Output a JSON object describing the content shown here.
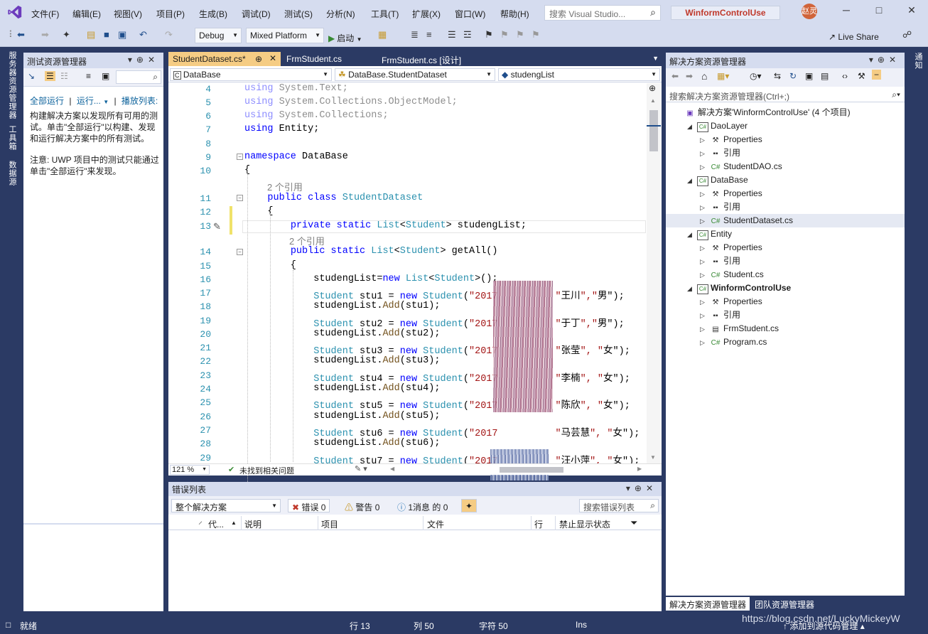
{
  "menu": [
    "文件(F)",
    "编辑(E)",
    "视图(V)",
    "项目(P)",
    "生成(B)",
    "调试(D)",
    "测试(S)",
    "分析(N)",
    "工具(T)",
    "扩展(X)",
    "窗口(W)",
    "帮助(H)"
  ],
  "search": {
    "placeholder": "搜索 Visual Studio..."
  },
  "solution_name": "WinformControlUse",
  "avatar_text": "赵灵",
  "toolbar": {
    "config": "Debug",
    "platform": "Mixed Platform",
    "start": "启动",
    "live_share": "Live Share"
  },
  "left_vtabs": [
    "服务器资源管理器",
    "工具箱",
    "数据源"
  ],
  "test_explorer": {
    "title": "测试资源管理器",
    "links": [
      "全部运行",
      "运行...",
      "播放列表:"
    ],
    "message1": "构建解决方案以发现所有可用的测试。单击\"全部运行\"以构建、发现和运行解决方案中的所有测试。",
    "message2": "注意: UWP 项目中的测试只能通过单击\"全部运行\"来发现。"
  },
  "doc_tabs": [
    {
      "label": "StudentDataset.cs*",
      "active": true
    },
    {
      "label": "FrmStudent.cs",
      "active": false
    },
    {
      "label": "FrmStudent.cs [设计]",
      "active": false
    }
  ],
  "nav": {
    "project": "DataBase",
    "type": "DataBase.StudentDataset",
    "member": "studengList"
  },
  "code": [
    {
      "n": "4",
      "t": "using System.Text;"
    },
    {
      "n": "5",
      "t": "using System.Collections.ObjectModel;"
    },
    {
      "n": "6",
      "t": "using System.Collections;"
    },
    {
      "n": "7",
      "t": "using Entity;"
    },
    {
      "n": "8",
      "t": ""
    },
    {
      "n": "9",
      "t": "namespace DataBase"
    },
    {
      "n": "10",
      "t": "{"
    },
    {
      "n": "11",
      "t": "    public class StudentDataset"
    },
    {
      "n": "12",
      "t": "    {"
    },
    {
      "n": "13",
      "t": "        private static List<Student> studengList;"
    },
    {
      "n": "14",
      "t": "        public static List<Student> getAll()"
    },
    {
      "n": "15",
      "t": "        {"
    },
    {
      "n": "16",
      "t": "            studengList=new List<Student>();"
    },
    {
      "n": "17",
      "t": "            Student stu1 = new Student(\"2017          \"王川\",\"男\");"
    },
    {
      "n": "18",
      "t": "            studengList.Add(stu1);"
    },
    {
      "n": "19",
      "t": "            Student stu2 = new Student(\"2017          \"于丁\",\"男\");"
    },
    {
      "n": "20",
      "t": "            studengList.Add(stu2);"
    },
    {
      "n": "21",
      "t": "            Student stu3 = new Student(\"2017          \"张莹\", \"女\");"
    },
    {
      "n": "22",
      "t": "            studengList.Add(stu3);"
    },
    {
      "n": "23",
      "t": "            Student stu4 = new Student(\"2017          \"李楠\", \"女\");"
    },
    {
      "n": "24",
      "t": "            studengList.Add(stu4);"
    },
    {
      "n": "25",
      "t": "            Student stu5 = new Student(\"2017          \"陈欣\", \"女\");"
    },
    {
      "n": "26",
      "t": "            studengList.Add(stu5);"
    },
    {
      "n": "27",
      "t": "            Student stu6 = new Student(\"2017          \"马芸慧\", \"女\");"
    },
    {
      "n": "28",
      "t": "            studengList.Add(stu6);"
    },
    {
      "n": "29",
      "t": "            Student stu7 = new Student(\"2017          \"汪小萍\", \"女\");"
    }
  ],
  "refs": [
    "2 个引用",
    "2 个引用"
  ],
  "editor_status": {
    "zoom": "121 %",
    "issues": "未找到相关问题"
  },
  "error_list": {
    "title": "错误列表",
    "scope": "整个解决方案",
    "errors": "错误 0",
    "warnings": "警告 0",
    "messages": "1消息 的 0",
    "search_placeholder": "搜索错误列表",
    "columns": [
      "代...",
      "说明",
      "项目",
      "文件",
      "行",
      "禁止显示状态"
    ]
  },
  "solution_explorer": {
    "title": "解决方案资源管理器",
    "search_placeholder": "搜索解决方案资源管理器(Ctrl+;)",
    "nodes": [
      {
        "label": "解决方案'WinformControlUse' (4 个项目)",
        "icon": "solution-icon"
      },
      {
        "label": "DaoLayer",
        "icon": "csproj-icon"
      },
      {
        "label": "Properties",
        "icon": "wrench-icon"
      },
      {
        "label": "引用",
        "icon": "references-icon"
      },
      {
        "label": "StudentDAO.cs",
        "icon": "cs-file-icon"
      },
      {
        "label": "DataBase",
        "icon": "csproj-icon"
      },
      {
        "label": "Properties",
        "icon": "wrench-icon"
      },
      {
        "label": "引用",
        "icon": "references-icon"
      },
      {
        "label": "StudentDataset.cs",
        "icon": "cs-file-icon"
      },
      {
        "label": "Entity",
        "icon": "csproj-icon"
      },
      {
        "label": "Properties",
        "icon": "wrench-icon"
      },
      {
        "label": "引用",
        "icon": "references-icon"
      },
      {
        "label": "Student.cs",
        "icon": "cs-file-icon"
      },
      {
        "label": "WinformControlUse",
        "icon": "csproj-icon"
      },
      {
        "label": "Properties",
        "icon": "wrench-icon"
      },
      {
        "label": "引用",
        "icon": "references-icon"
      },
      {
        "label": "FrmStudent.cs",
        "icon": "form-icon"
      },
      {
        "label": "Program.cs",
        "icon": "cs-file-icon"
      }
    ],
    "bottom_tabs": [
      "解决方案资源管理器",
      "团队资源管理器"
    ]
  },
  "right_vtab": "通知",
  "status": {
    "ready": "就绪",
    "line": "行 13",
    "col": "列 50",
    "char": "字符 50",
    "mode": "Ins",
    "add_source": "添加到源代码管理"
  },
  "watermark": "https://blog.csdn.net/LuckyMickeyW"
}
